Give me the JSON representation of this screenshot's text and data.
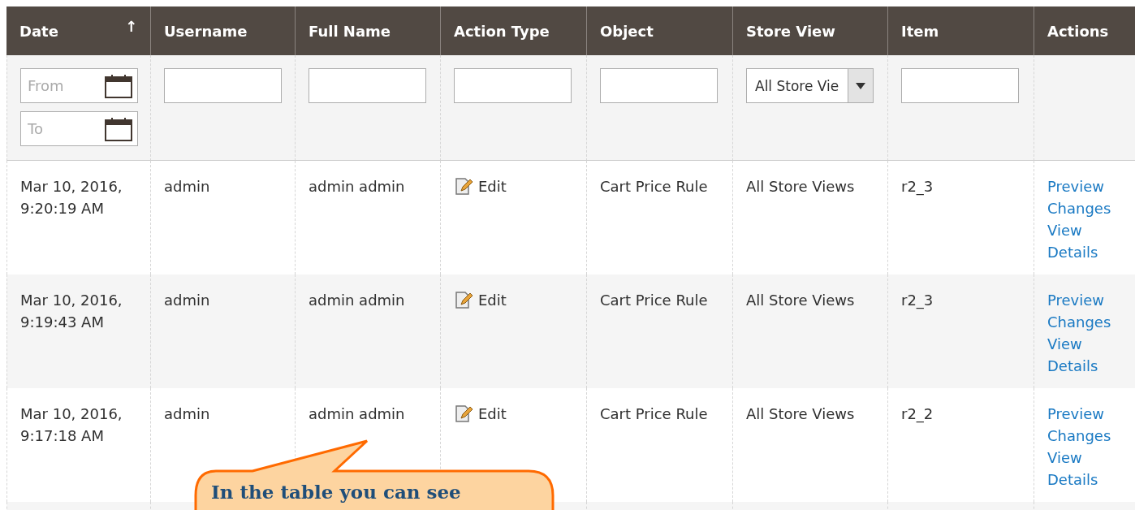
{
  "table": {
    "columns": [
      {
        "label": "Date",
        "sort_indicator": "↑"
      },
      {
        "label": "Username"
      },
      {
        "label": "Full Name"
      },
      {
        "label": "Action Type"
      },
      {
        "label": "Object"
      },
      {
        "label": "Store View"
      },
      {
        "label": "Item"
      },
      {
        "label": "Actions"
      }
    ],
    "filters": {
      "date_from": {
        "placeholder": "From"
      },
      "date_to": {
        "placeholder": "To"
      },
      "store_view": {
        "value": "All Store Vie"
      }
    },
    "rows": [
      {
        "date": "Mar 10, 2016,",
        "time": "9:20:19 AM",
        "username": "admin",
        "full_name": "admin admin",
        "action_type": "Edit",
        "object": "Cart Price Rule",
        "store_view": "All Store Views",
        "item": "r2_3",
        "actions": [
          "Preview Changes",
          "View Details"
        ]
      },
      {
        "date": "Mar 10, 2016,",
        "time": "9:19:43 AM",
        "username": "admin",
        "full_name": "admin admin",
        "action_type": "Edit",
        "object": "Cart Price Rule",
        "store_view": "All Store Views",
        "item": "r2_3",
        "actions": [
          "Preview Changes",
          "View Details"
        ]
      },
      {
        "date": "Mar 10, 2016,",
        "time": "9:17:18 AM",
        "username": "admin",
        "full_name": "admin admin",
        "action_type": "Edit",
        "object": "Cart Price Rule",
        "store_view": "All Store Views",
        "item": "r2_2",
        "actions": [
          "Preview Changes",
          "View Details"
        ]
      }
    ]
  },
  "callout": {
    "text": "In the table you can see"
  }
}
